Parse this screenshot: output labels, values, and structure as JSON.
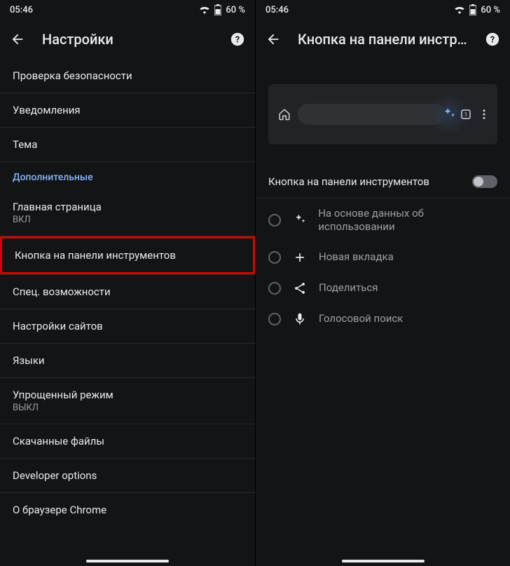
{
  "status": {
    "time": "05:46",
    "battery": "60 %"
  },
  "left": {
    "title": "Настройки",
    "items": [
      {
        "label": "Проверка безопасности"
      },
      {
        "label": "Уведомления"
      },
      {
        "label": "Тема"
      }
    ],
    "section": "Дополнительные",
    "items2": [
      {
        "label": "Главная страница",
        "sub": "ВКЛ"
      },
      {
        "label": "Кнопка на панели инструментов",
        "highlight": true
      },
      {
        "label": "Спец. возможности"
      },
      {
        "label": "Настройки сайтов"
      },
      {
        "label": "Языки"
      },
      {
        "label": "Упрощенный режим",
        "sub": "ВЫКЛ"
      },
      {
        "label": "Скачанные файлы"
      },
      {
        "label": "Developer options"
      },
      {
        "label": "О браузере Chrome"
      }
    ]
  },
  "right": {
    "title": "Кнопка на панели инстр…",
    "switch_label": "Кнопка на панели инструментов",
    "options": [
      {
        "icon": "sparkle",
        "label": "На основе данных об использовании"
      },
      {
        "icon": "plus",
        "label": "Новая вкладка"
      },
      {
        "icon": "share",
        "label": "Поделиться"
      },
      {
        "icon": "mic",
        "label": "Голосовой поиск"
      }
    ]
  }
}
